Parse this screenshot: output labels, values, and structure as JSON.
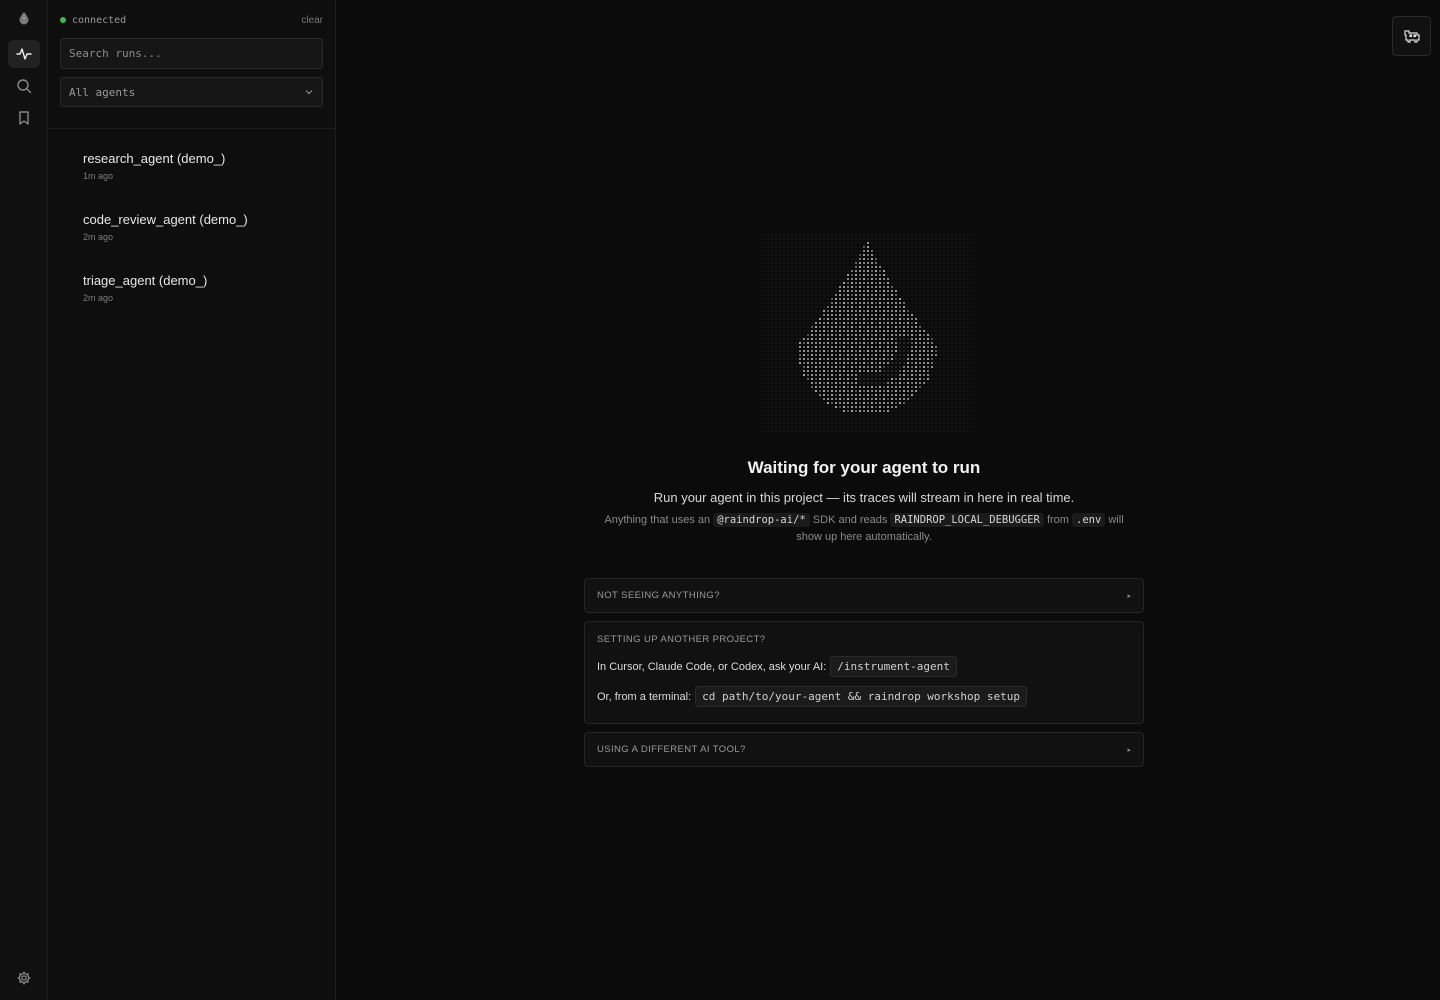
{
  "rail": {
    "logo_icon": "raindrop-logo-icon",
    "items": [
      {
        "name": "activity-icon",
        "active": true
      },
      {
        "name": "search-icon",
        "active": false
      },
      {
        "name": "bookmark-icon",
        "active": false
      }
    ],
    "settings_icon": "gear-icon"
  },
  "sidebar": {
    "status": "connected",
    "clear_label": "clear",
    "search_placeholder": "Search runs...",
    "agent_filter": "All agents",
    "runs": [
      {
        "name": "research_agent (demo_)",
        "time": "1m ago"
      },
      {
        "name": "code_review_agent (demo_)",
        "time": "2m ago"
      },
      {
        "name": "triage_agent (demo_)",
        "time": "2m ago"
      }
    ]
  },
  "main": {
    "title": "Waiting for your agent to run",
    "subtitle": "Run your agent in this project — its traces will stream in here in real time.",
    "hint": {
      "prefix": "Anything that uses an",
      "sdk": "@raindrop-ai/*",
      "mid": "SDK and reads",
      "env_var": "RAINDROP_LOCAL_DEBUGGER",
      "from": "from",
      "env_file": ".env",
      "suffix": "will show up here automatically."
    },
    "panels": {
      "not_seeing": "NOT SEEING ANYTHING?",
      "setup": {
        "title": "SETTING UP ANOTHER PROJECT?",
        "ai_label": "In Cursor, Claude Code, or Codex, ask your AI:",
        "ai_command": "/instrument-agent",
        "terminal_label": "Or, from a terminal:",
        "terminal_command": "cd path/to/your-agent && raindrop workshop setup"
      },
      "different_tool": "USING A DIFFERENT AI TOOL?"
    }
  },
  "colors": {
    "background": "#0b0b0b",
    "status_ok": "#3fb950",
    "text": "#e6e6e6"
  }
}
